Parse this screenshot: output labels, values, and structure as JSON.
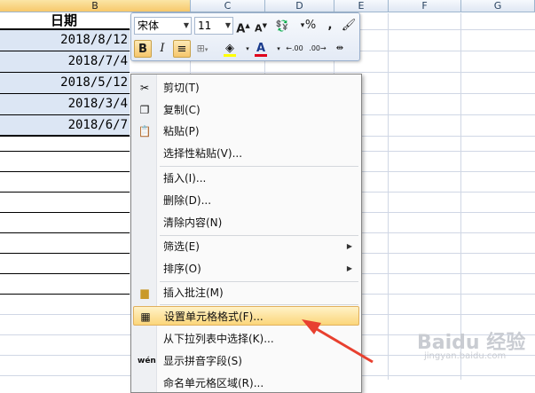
{
  "columns": [
    "B",
    "C",
    "D",
    "E",
    "F",
    "G"
  ],
  "header_cell": "日期",
  "dates": [
    "2018/8/12",
    "2018/7/4",
    "2018/5/12",
    "2018/3/4",
    "2018/6/7"
  ],
  "mini_toolbar": {
    "font_name": "宋体",
    "font_size": "11",
    "grow_font": "A",
    "shrink_font": "A",
    "percent": "%",
    "comma": ",",
    "bold": "B",
    "italic": "I",
    "font_color": "A",
    "inc_decimal": ".00",
    "dec_decimal": ".00"
  },
  "menu": [
    {
      "label": "剪切(T)",
      "icon": "scissors-icon"
    },
    {
      "label": "复制(C)",
      "icon": "copy-icon"
    },
    {
      "label": "粘贴(P)",
      "icon": "paste-icon"
    },
    {
      "label": "选择性粘贴(V)...",
      "icon": ""
    },
    {
      "label": "插入(I)...",
      "icon": ""
    },
    {
      "label": "删除(D)...",
      "icon": ""
    },
    {
      "label": "清除内容(N)",
      "icon": ""
    },
    {
      "label": "筛选(E)",
      "icon": "",
      "submenu": true
    },
    {
      "label": "排序(O)",
      "icon": "",
      "submenu": true
    },
    {
      "label": "插入批注(M)",
      "icon": "comment-icon"
    },
    {
      "label": "设置单元格格式(F)...",
      "icon": "format-cells-icon",
      "highlighted": true
    },
    {
      "label": "从下拉列表中选择(K)...",
      "icon": ""
    },
    {
      "label": "显示拼音字段(S)",
      "icon": "phonetic-icon"
    },
    {
      "label": "命名单元格区域(R)...",
      "icon": ""
    }
  ],
  "watermark": {
    "main": "Baidu 经验",
    "sub": "jingyan.baidu.com"
  },
  "colors": {
    "highlight": "#fbd67a",
    "arrow": "#e8402f",
    "selected_row": "#dce6f4"
  }
}
